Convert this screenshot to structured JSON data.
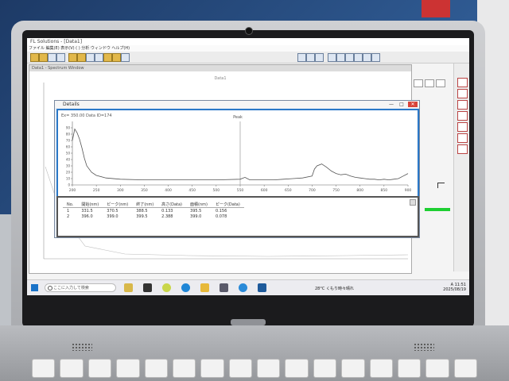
{
  "app": {
    "title": "FL Solutions - [Data1]",
    "menu": "ファイル  編集(E)  表示(V)  (  )  分析  ウィンドウ  ヘルプ(H)",
    "mdi_title": "Data1 - Spectrum Window",
    "bg_plot_title": "Data1"
  },
  "dialog": {
    "title": "Details",
    "info_line": "Ex= 350.00  Data ID=174",
    "chart_title": "Peak",
    "btn_min": "—",
    "btn_max": "□",
    "btn_close": "✕"
  },
  "table": {
    "headers": [
      "No.",
      "開始(nm)",
      "ピーク(nm)",
      "終了(nm)",
      "高さ(Data)",
      "面積(nm)",
      "ピーク(Data)"
    ],
    "rows": [
      [
        "1",
        "331.5",
        "370.5",
        "388.5",
        "0.133",
        "395.5",
        "0.156"
      ],
      [
        "2",
        "396.0",
        "399.0",
        "399.5",
        "2.388",
        "399.0",
        "0.078"
      ]
    ]
  },
  "taskbar": {
    "search_placeholder": "ここに入力して検索",
    "weather": "28°C  くもり時々晴れ",
    "ime": "A",
    "time": "11:51",
    "date": "2025/08/19"
  },
  "colors": {
    "accent_frame": "#2a78c8",
    "status_green": "#1ecf32",
    "close_red": "#d9443a"
  },
  "chart_data": {
    "type": "line",
    "title": "Peak",
    "xlim": [
      200,
      900
    ],
    "ylim": [
      0,
      100
    ],
    "x_ticks": [
      200,
      250,
      300,
      350,
      400,
      450,
      500,
      550,
      600,
      650,
      700,
      750,
      800,
      850,
      900
    ],
    "y_ticks": [
      0,
      10,
      20,
      30,
      40,
      50,
      60,
      70,
      80,
      90
    ],
    "series": [
      {
        "x": [
          200,
          205,
          210,
          215,
          220,
          225,
          230,
          240,
          250,
          270,
          300,
          350,
          400,
          450,
          500,
          550,
          560,
          565,
          570,
          580,
          600,
          620,
          640,
          660,
          680,
          700,
          705,
          710,
          720,
          730,
          740,
          750,
          760,
          770,
          780,
          790,
          800,
          810,
          820,
          830,
          840,
          850,
          860,
          870,
          880,
          890,
          900
        ],
        "y": [
          70,
          88,
          82,
          72,
          58,
          42,
          30,
          20,
          15,
          11,
          9,
          8,
          8,
          8,
          8,
          9,
          12,
          10,
          8,
          8,
          8,
          8,
          9,
          10,
          11,
          14,
          25,
          30,
          33,
          28,
          22,
          18,
          16,
          17,
          14,
          12,
          11,
          10,
          9,
          9,
          8,
          9,
          8,
          9,
          10,
          14,
          18
        ]
      }
    ],
    "vertical_marker_x": 550,
    "grid": false
  }
}
